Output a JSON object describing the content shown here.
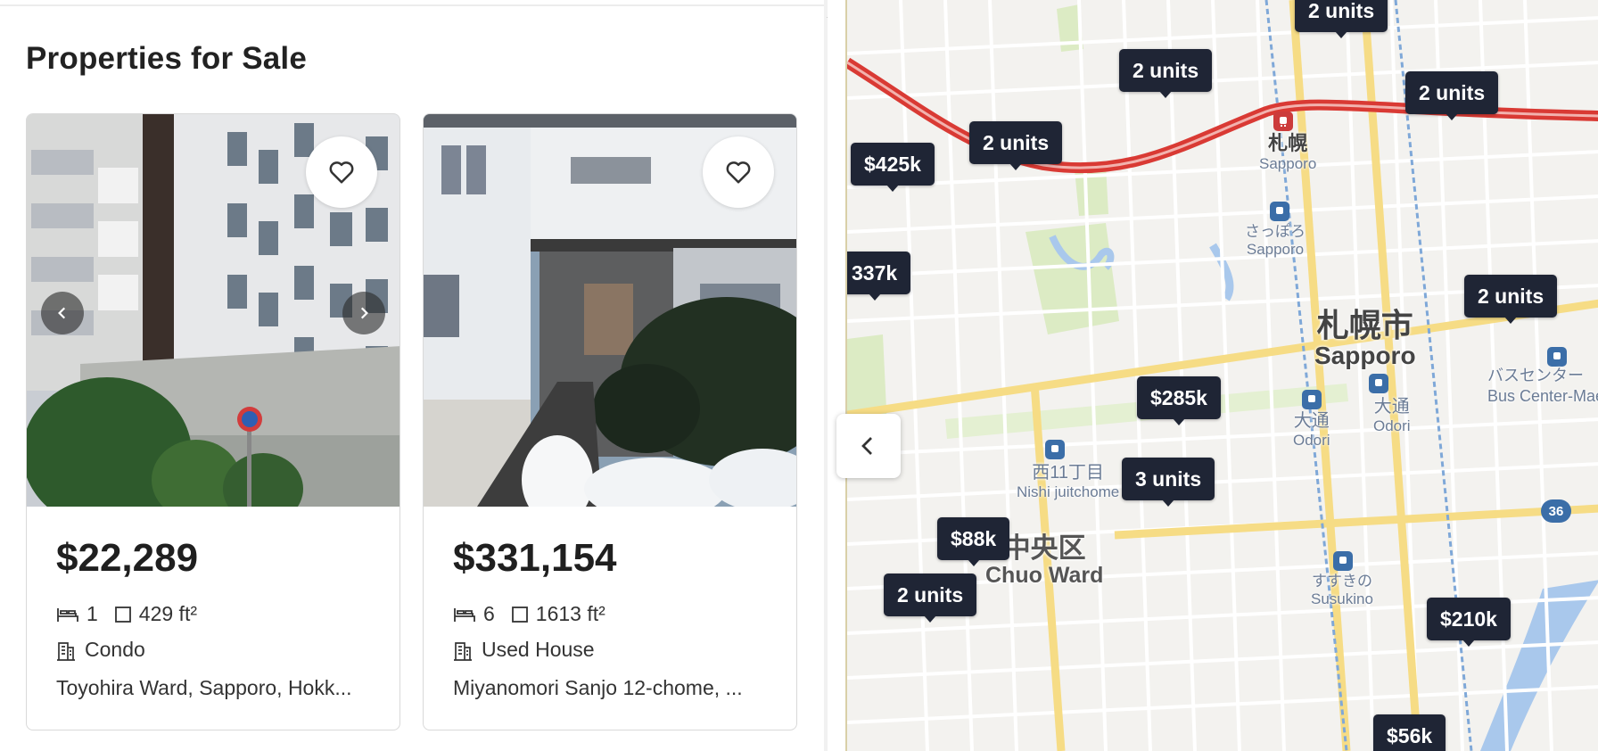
{
  "page": {
    "title": "Properties for Sale"
  },
  "listings": [
    {
      "price": "$22,289",
      "bedrooms": "1",
      "area": "429 ft²",
      "type": "Condo",
      "address": "Toyohira Ward, Sapporo, Hokk...",
      "has_photo_nav": true
    },
    {
      "price": "$331,154",
      "bedrooms": "6",
      "area": "1613 ft²",
      "type": "Used House",
      "address": "Miyanomori Sanjo 12-chome, ...",
      "has_photo_nav": false
    }
  ],
  "icons": {
    "favorite": "heart-outline-icon",
    "bed": "bed-icon",
    "area": "square-icon",
    "building": "building-icon",
    "prev": "chevron-left-icon",
    "next": "chevron-right-icon",
    "collapse": "chevron-left-icon"
  },
  "map": {
    "pins": [
      {
        "label": "2 units"
      },
      {
        "label": "2 units"
      },
      {
        "label": "2 units"
      },
      {
        "label": "2 units"
      },
      {
        "label": "$425k"
      },
      {
        "label": "337k"
      },
      {
        "label": "2 units"
      },
      {
        "label": "$285k"
      },
      {
        "label": "3 units"
      },
      {
        "label": "$88k"
      },
      {
        "label": "2 units"
      },
      {
        "label": "$210k"
      },
      {
        "label": "$56k"
      }
    ],
    "labels": {
      "sapporo_station_jp": "札幌",
      "sapporo_station_en": "Sapporo",
      "sapporo_subway_jp": "さっぽろ",
      "sapporo_subway_en": "Sapporo",
      "city_jp": "札幌市",
      "city_en": "Sapporo",
      "odori_west_jp": "大通",
      "odori_west_en": "Odori",
      "odori_east_jp": "大通",
      "odori_east_en": "Odori",
      "nishi11_jp": "西11丁目",
      "nishi11_en": "Nishi juitchome",
      "ward_jp": "中央区",
      "ward_en": "Chuo Ward",
      "susukino_jp": "すすきの",
      "susukino_en": "Susukino",
      "bus_center_jp": "バスセンター",
      "bus_center_en": "Bus Center-Mae",
      "route_36": "36"
    },
    "colors": {
      "pin_bg": "#1f2535",
      "highway": "#d93a34",
      "major_road": "#f6dc85",
      "park": "#dcebc4",
      "water": "#a9c8ec",
      "subway": "#3b6ea8"
    }
  }
}
